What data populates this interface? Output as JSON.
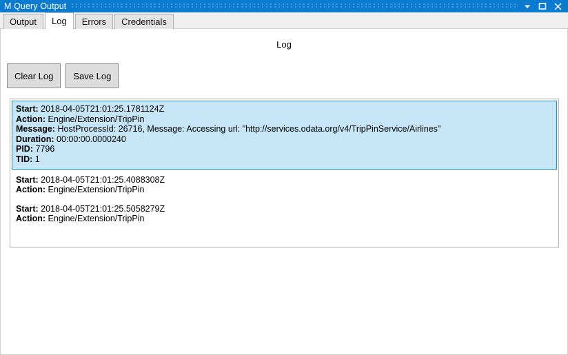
{
  "window": {
    "title": "M Query Output",
    "controls": [
      {
        "name": "dropdown-button",
        "icon": "chevron-down-icon"
      },
      {
        "name": "maximize-button",
        "icon": "maximize-icon"
      },
      {
        "name": "close-button",
        "icon": "close-icon"
      }
    ],
    "accent_color": "#0a7bce"
  },
  "tabs": [
    {
      "label": "Output",
      "active": false
    },
    {
      "label": "Log",
      "active": true
    },
    {
      "label": "Errors",
      "active": false
    },
    {
      "label": "Credentials",
      "active": false
    }
  ],
  "main": {
    "heading": "Log",
    "buttons": {
      "clear": "Clear Log",
      "save": "Save Log"
    },
    "labels": {
      "start": "Start:",
      "action": "Action:",
      "message": "Message:",
      "duration": "Duration:",
      "pid": "PID:",
      "tid": "TID:"
    },
    "entries": [
      {
        "selected": true,
        "start": "2018-04-05T21:01:25.1781124Z",
        "action": "Engine/Extension/TripPin",
        "message": "HostProcessId: 26716, Message: Accessing url: \"http://services.odata.org/v4/TripPinService/Airlines\"",
        "duration": "00:00:00.0000240",
        "pid": "7796",
        "tid": "1"
      },
      {
        "selected": false,
        "start": "2018-04-05T21:01:25.4088308Z",
        "action": "Engine/Extension/TripPin"
      },
      {
        "selected": false,
        "start": "2018-04-05T21:01:25.5058279Z",
        "action": "Engine/Extension/TripPin"
      }
    ],
    "selection_fill": "#c6e6f7",
    "selection_border": "#1c8fd0"
  }
}
